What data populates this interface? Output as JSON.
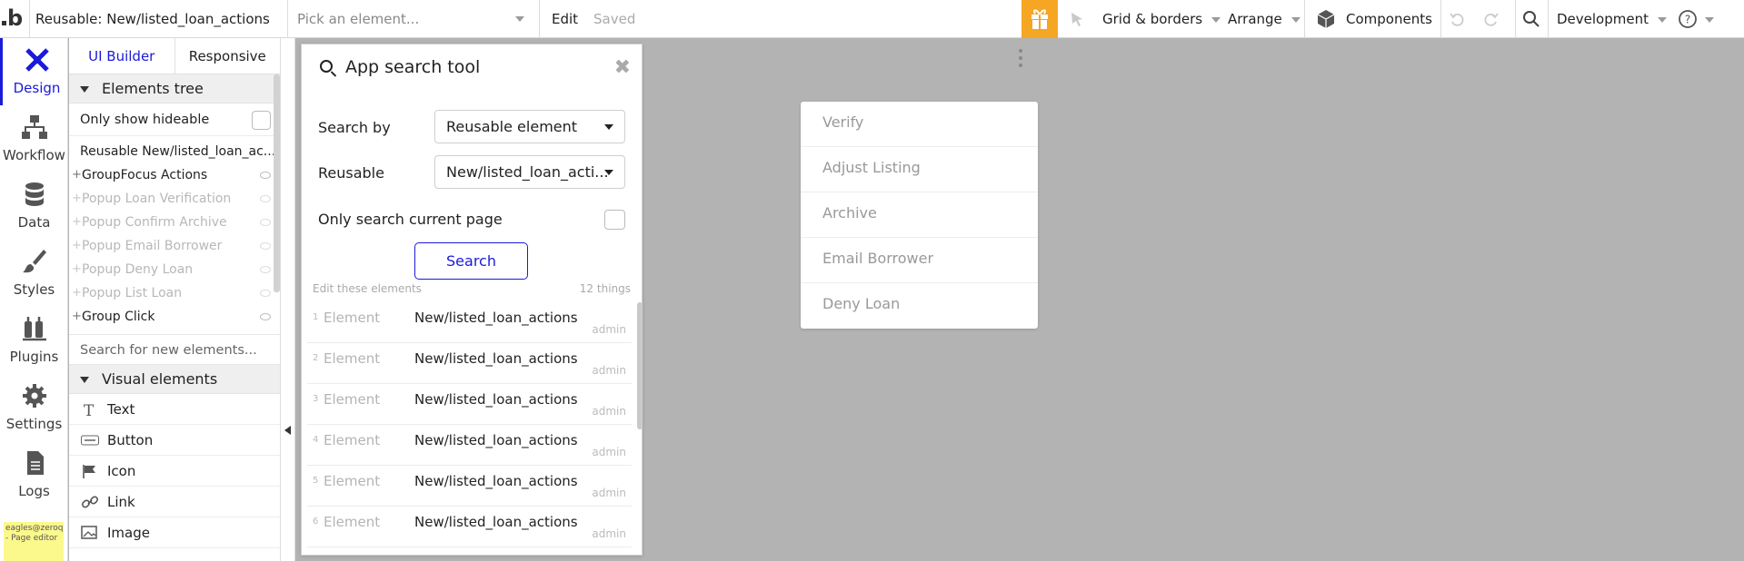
{
  "topbar": {
    "page_selector": "Reusable: New/listed_loan_actions",
    "element_picker_placeholder": "Pick an element...",
    "edit_label": "Edit",
    "saved_label": "Saved",
    "grid_label": "Grid & borders",
    "arrange_label": "Arrange",
    "components_label": "Components",
    "env_label": "Development",
    "gift_color": "#f5a623"
  },
  "leftnav": {
    "items": [
      {
        "label": "Design",
        "icon": "design-icon"
      },
      {
        "label": "Workflow",
        "icon": "workflow-icon"
      },
      {
        "label": "Data",
        "icon": "data-icon"
      },
      {
        "label": "Styles",
        "icon": "styles-icon"
      },
      {
        "label": "Plugins",
        "icon": "plugins-icon"
      },
      {
        "label": "Settings",
        "icon": "settings-icon"
      },
      {
        "label": "Logs",
        "icon": "logs-icon"
      }
    ],
    "email_note": "eagles@zeroqode.com - Page editor"
  },
  "panel": {
    "tabs": [
      "UI Builder",
      "Responsive"
    ],
    "elements_tree_label": "Elements tree",
    "only_hideable_label": "Only show hideable",
    "tree": [
      {
        "label": "Reusable New/listed_loan_ac..."
      },
      {
        "label": "GroupFocus Actions"
      },
      {
        "label": "Popup Loan Verification"
      },
      {
        "label": "Popup Confirm Archive"
      },
      {
        "label": "Popup Email Borrower"
      },
      {
        "label": "Popup Deny Loan"
      },
      {
        "label": "Popup List Loan"
      },
      {
        "label": "Group Click"
      }
    ],
    "search_new_placeholder": "Search for new elements...",
    "visual_elements_label": "Visual elements",
    "visual_elements": [
      {
        "label": "Text"
      },
      {
        "label": "Button"
      },
      {
        "label": "Icon"
      },
      {
        "label": "Link"
      },
      {
        "label": "Image"
      }
    ]
  },
  "search_tool": {
    "title": "App search tool",
    "search_by_label": "Search by",
    "search_by_value": "Reusable element",
    "reusable_label": "Reusable",
    "reusable_value": "New/listed_loan_acti...",
    "only_current_label": "Only search current page",
    "search_button": "Search",
    "edit_these_label": "Edit these elements",
    "count_label": "12 things",
    "results": [
      {
        "n": "1",
        "kind": "Element",
        "value": "New/listed_loan_actions",
        "page": "admin"
      },
      {
        "n": "2",
        "kind": "Element",
        "value": "New/listed_loan_actions",
        "page": "admin"
      },
      {
        "n": "3",
        "kind": "Element",
        "value": "New/listed_loan_actions",
        "page": "admin"
      },
      {
        "n": "4",
        "kind": "Element",
        "value": "New/listed_loan_actions",
        "page": "admin"
      },
      {
        "n": "5",
        "kind": "Element",
        "value": "New/listed_loan_actions",
        "page": "admin"
      },
      {
        "n": "6",
        "kind": "Element",
        "value": "New/listed_loan_actions",
        "page": "admin"
      }
    ]
  },
  "canvas": {
    "menu": [
      "Verify",
      "Adjust Listing",
      "Archive",
      "Email Borrower",
      "Deny Loan"
    ]
  }
}
